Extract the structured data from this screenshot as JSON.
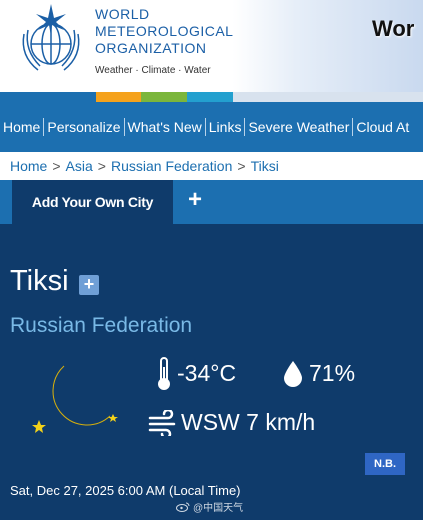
{
  "header": {
    "org_line1": "WORLD",
    "org_line2": "METEOROLOGICAL",
    "org_line3": "ORGANIZATION",
    "tagline": "Weather · Climate · Water",
    "right_text": "Wor"
  },
  "stripe_colors": [
    "#1c6fb0",
    "#f5a21c",
    "#7bb63c",
    "#23a0cf",
    "#d8e2ee"
  ],
  "nav": {
    "items": [
      "Home",
      "Personalize",
      "What's New",
      "Links",
      "Severe Weather",
      "Cloud At"
    ]
  },
  "breadcrumb": {
    "items": [
      "Home",
      "Asia",
      "Russian Federation",
      "Tiksi"
    ],
    "separator": ">"
  },
  "tabs": {
    "active_label": "Add Your Own City",
    "add_symbol": "+"
  },
  "weather": {
    "city": "Tiksi",
    "add_symbol": "+",
    "country": "Russian Federation",
    "condition_icon": "night-clear-moon-icon",
    "temperature": "-34°C",
    "humidity": "71%",
    "wind": "WSW 7 km/h",
    "nb_label": "N.B.",
    "timestamp": "Sat, Dec 27, 2025 6:00 AM (Local Time)"
  },
  "watermark": {
    "text": "@中国天气"
  },
  "colors": {
    "page_bg": "#0f3b6b",
    "nav_bg": "#1c6fb0",
    "country_text": "#79b9e6",
    "moon": "#f3d21a",
    "nb_bg": "#2f66c4"
  }
}
